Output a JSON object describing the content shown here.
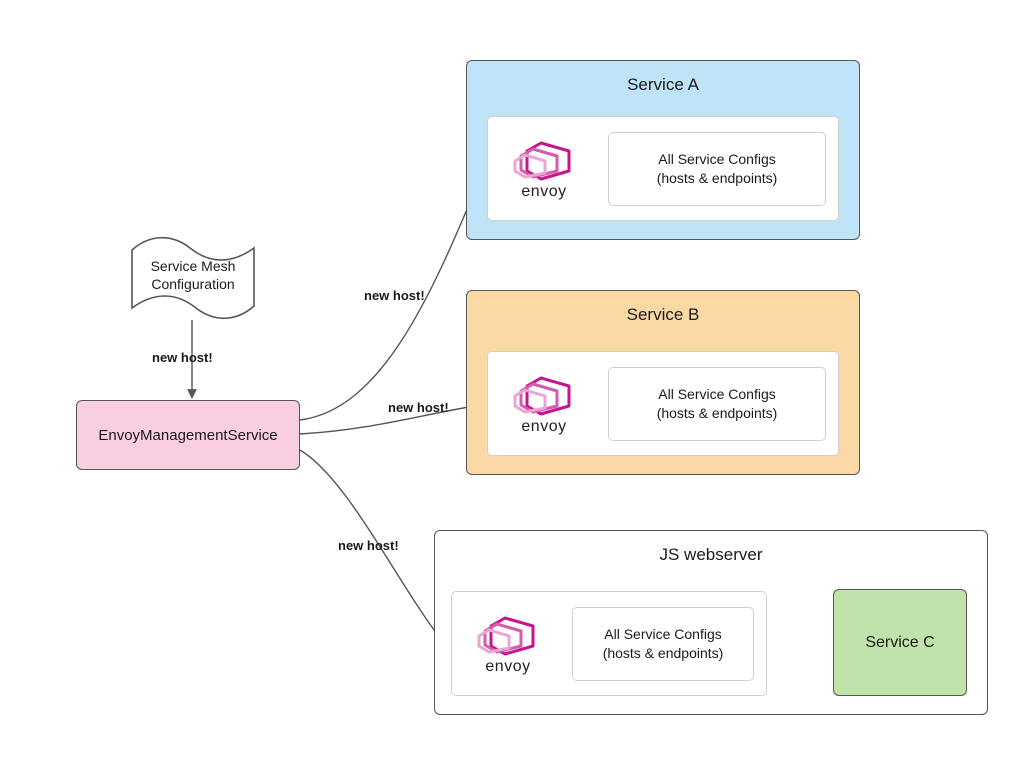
{
  "nodes": {
    "service_mesh_doc": {
      "line1": "Service Mesh",
      "line2": "Configuration"
    },
    "ems": {
      "label": "EnvoyManagementService"
    },
    "serviceA": {
      "title": "Service A"
    },
    "serviceB": {
      "title": "Service B"
    },
    "js_webserver": {
      "title": "JS webserver"
    },
    "serviceC": {
      "label": "Service C"
    },
    "envoy_word": "envoy",
    "config_box": {
      "line1": "All Service Configs",
      "line2": "(hosts & endpoints)"
    }
  },
  "edges": {
    "mesh_to_ems": {
      "label": "new host!"
    },
    "ems_to_svcA": {
      "label": "new host!"
    },
    "ems_to_svcB": {
      "label": "new host!"
    },
    "ems_to_jsws": {
      "label": "new host!"
    }
  },
  "colors": {
    "ems_fill": "#f9cee0",
    "svcA_fill": "#bfe4f7",
    "svcB_fill": "#fbd9a4",
    "svcC_fill": "#bfe3a8",
    "box_border": "#555555",
    "inner_border": "#d0d0d0",
    "envoy_accent": "#c6168d",
    "envoy_accent_lt": "#e487c6"
  }
}
